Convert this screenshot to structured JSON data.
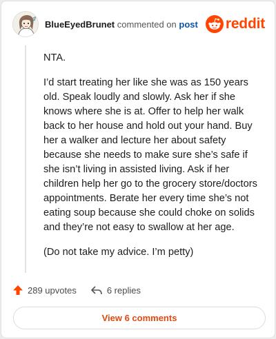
{
  "comment": {
    "author": "BlueEyedBrunet",
    "action_text": "commented on",
    "post_link": "post",
    "paragraphs": [
      "NTA.",
      "I’d start treating her like she was as 150 years old. Speak loudly and slowly. Ask her if she knows where she is at. Offer to help her walk back to her house and hold out your hand. Buy her a walker and lecture her about safety because she needs to make sure she’s safe if she isn’t living in assisted living. Ask if her children help her go to the grocery store/doctors appointments. Berate her every time she’s not eating soup because she could choke on solids and they’re not easy to swallow at her age.",
      "(Do not take my advice. I’m petty)"
    ]
  },
  "brand": {
    "wordmark": "reddit",
    "color": "#ff4500"
  },
  "actions": {
    "upvotes": "289 upvotes",
    "replies": "6 replies"
  },
  "footer": {
    "view_comments": "View 6 comments"
  },
  "icons": {
    "avatar": "user-avatar",
    "logo": "reddit-snoo-icon",
    "upvote": "upvote-arrow-icon",
    "reply": "reply-arrow-icon"
  }
}
